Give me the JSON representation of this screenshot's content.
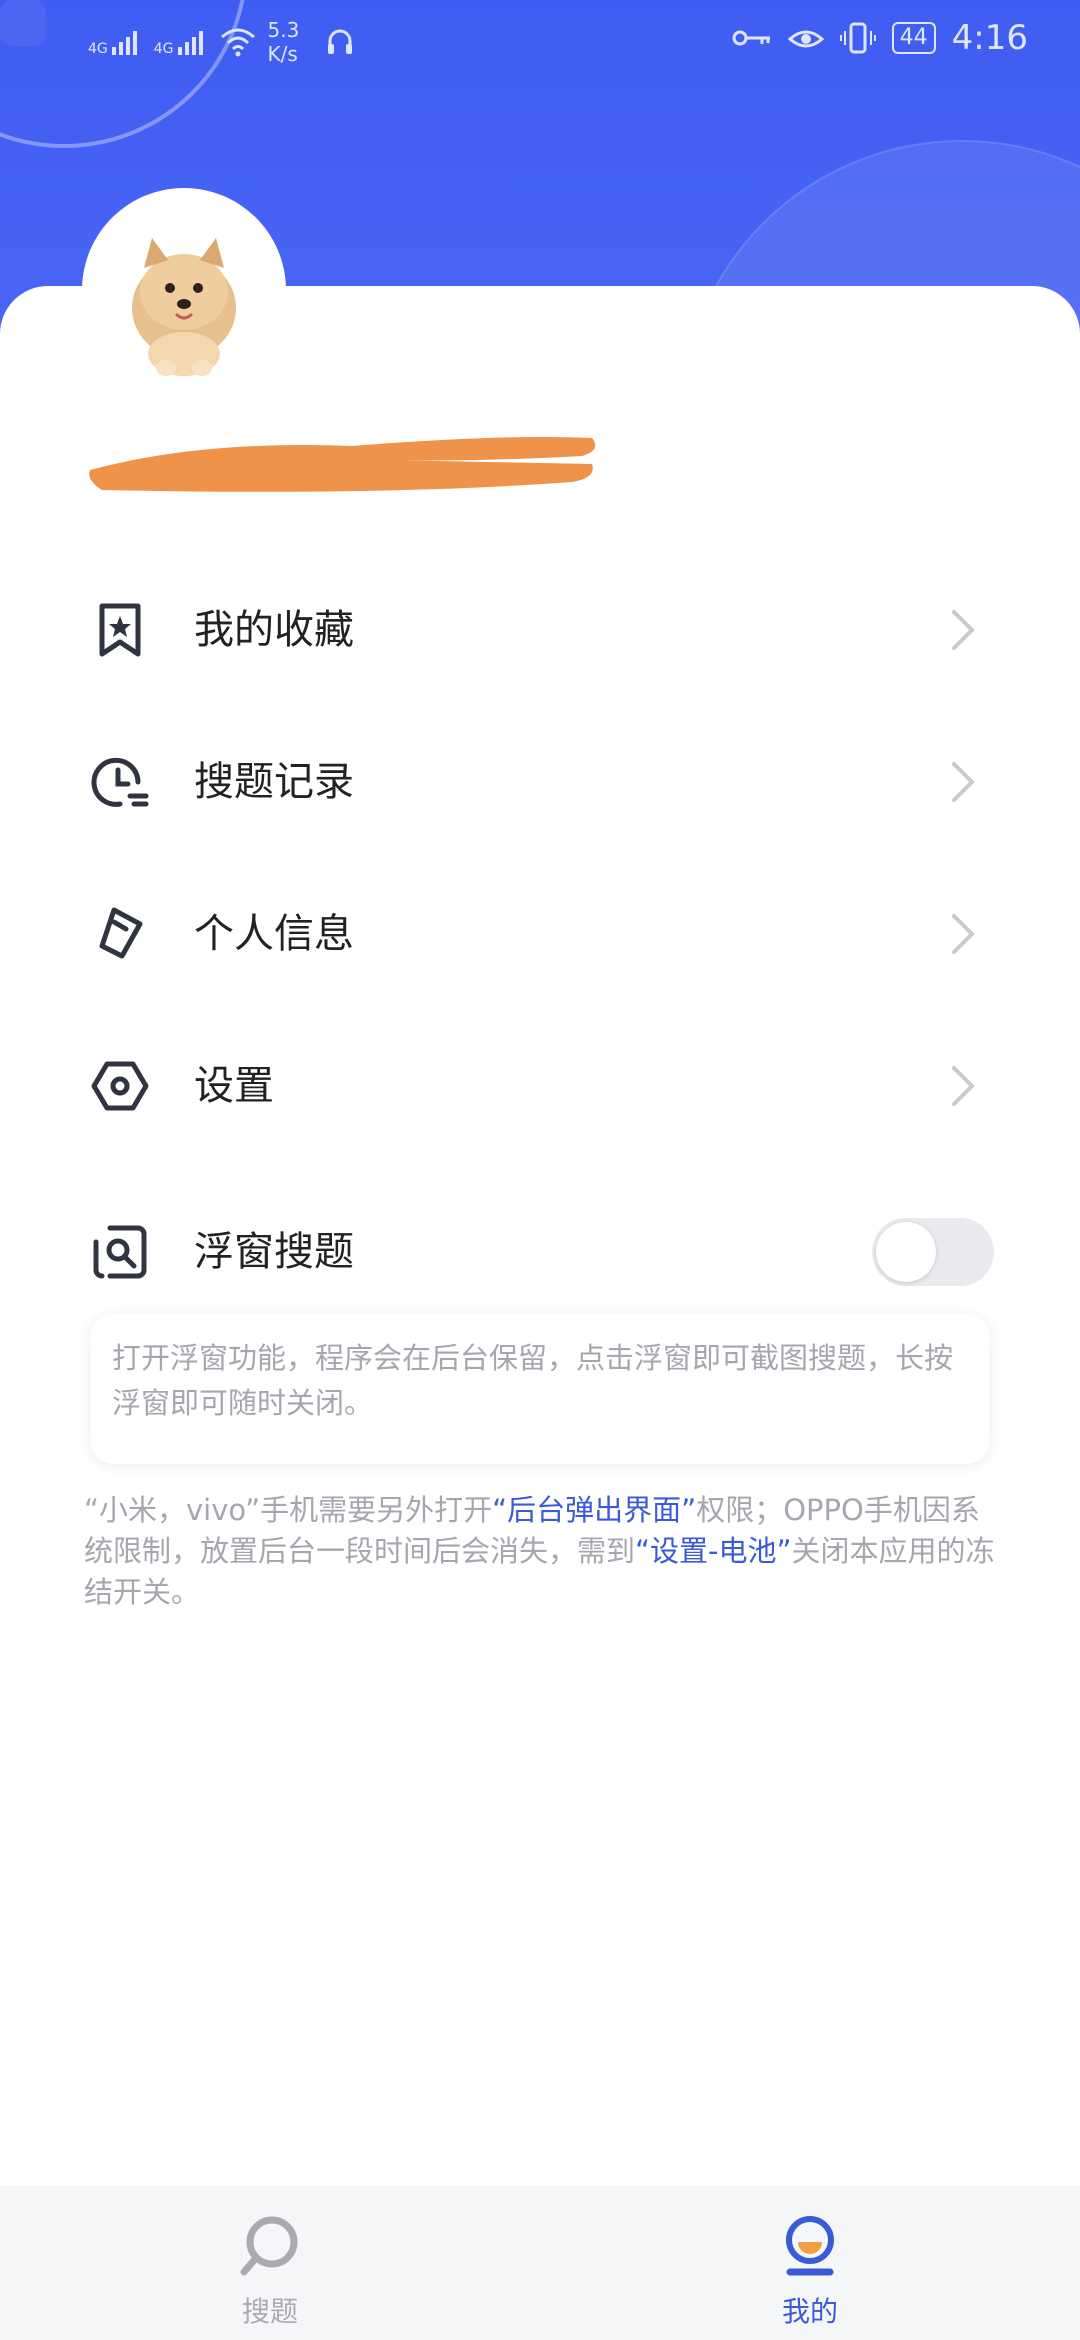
{
  "status_bar": {
    "net1": "4G",
    "net2": "4G",
    "speed_value": "5.3",
    "speed_unit": "K/s",
    "battery": "44",
    "time": "4:16"
  },
  "profile": {
    "name_redacted": true
  },
  "menu": [
    {
      "label": "我的收藏",
      "icon": "bookmark-star-icon"
    },
    {
      "label": "搜题记录",
      "icon": "clock-history-icon"
    },
    {
      "label": "个人信息",
      "icon": "edit-tag-icon"
    },
    {
      "label": "设置",
      "icon": "hexagon-settings-icon"
    }
  ],
  "float_search": {
    "label": "浮窗搜题",
    "icon": "float-window-search-icon",
    "enabled": false,
    "tip": "打开浮窗功能，程序会在后台保留，点击浮窗即可截图搜题，长按浮窗即可随时关闭。"
  },
  "note": {
    "part1": "“小米，vivo”手机需要另外打开",
    "hl1": "“后台弹出界面”",
    "part2": "权限；OPPO手机因系统限制，放置后台一段时间后会消失，需到",
    "hl2": "“设置-电池”",
    "part3": "关闭本应用的冻结开关。"
  },
  "tabbar": {
    "tabs": [
      {
        "label": "搜题",
        "icon": "search-bubble-icon",
        "active": false
      },
      {
        "label": "我的",
        "icon": "profile-icon",
        "active": true
      }
    ],
    "active_color": "#3a5ad6",
    "inactive_color": "#a9abb1"
  },
  "colors": {
    "header": "#3f5df2",
    "accent": "#3a5ad6",
    "redaction": "#f0934a"
  }
}
